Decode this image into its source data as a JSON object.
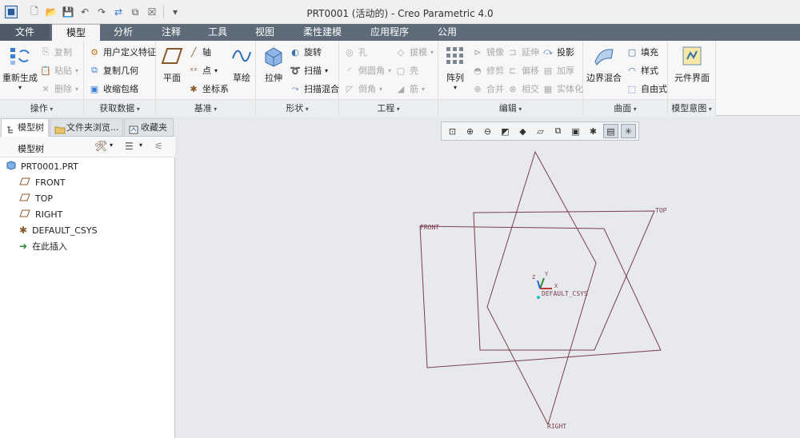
{
  "window": {
    "title": "PRT0001 (活动的) - Creo Parametric 4.0"
  },
  "tabs": [
    "文件",
    "模型",
    "分析",
    "注释",
    "工具",
    "视图",
    "柔性建模",
    "应用程序",
    "公用"
  ],
  "groups": {
    "operations": {
      "label": "操作",
      "regenerate": "重新生成",
      "copy": "复制",
      "paste": "粘贴",
      "delete": "删除"
    },
    "get_data": {
      "label": "获取数据",
      "udf": "用户定义特征",
      "copy_geom": "复制几何",
      "shrinkwrap": "收缩包络"
    },
    "datum": {
      "label": "基准",
      "plane": "平面",
      "axis": "轴",
      "point": "点",
      "csys": "坐标系",
      "sketch": "草绘"
    },
    "shapes": {
      "label": "形状",
      "extrude": "拉伸",
      "revolve": "旋转",
      "sweep": "扫描",
      "swept_blend": "扫描混合"
    },
    "engineering": {
      "label": "工程",
      "hole": "孔",
      "round": "倒圆角",
      "chamfer": "倒角",
      "draft": "拔模",
      "shell": "壳",
      "rib": "筋"
    },
    "editing": {
      "label": "编辑",
      "pattern": "阵列",
      "mirror": "镜像",
      "trim": "修剪",
      "merge": "合并",
      "extend": "延伸",
      "offset": "偏移",
      "intersect": "相交",
      "project": "投影",
      "thicken": "加厚",
      "solidify": "实体化"
    },
    "surfaces": {
      "label": "曲面",
      "boundary_blend": "边界混合",
      "fill": "填充",
      "style": "样式",
      "freestyle": "自由式"
    },
    "model_intent": {
      "label": "模型意图",
      "component_interface": "元件界面"
    }
  },
  "panel": {
    "tabs": [
      "模型树",
      "文件夹浏览...",
      "收藏夹"
    ],
    "tree_title": "模型树",
    "nodes": [
      "PRT0001.PRT",
      "FRONT",
      "TOP",
      "RIGHT",
      "DEFAULT_CSYS",
      "在此插入"
    ]
  },
  "viewport": {
    "datum_labels": {
      "front": "FRONT",
      "top": "TOP",
      "right": "RIGHT",
      "csys": "DEFAULT_CSYS",
      "x": "X",
      "y": "Y",
      "z": "Z"
    },
    "colors": {
      "datum_line": "#7a3e4e",
      "background": "#e7e9ec"
    }
  }
}
